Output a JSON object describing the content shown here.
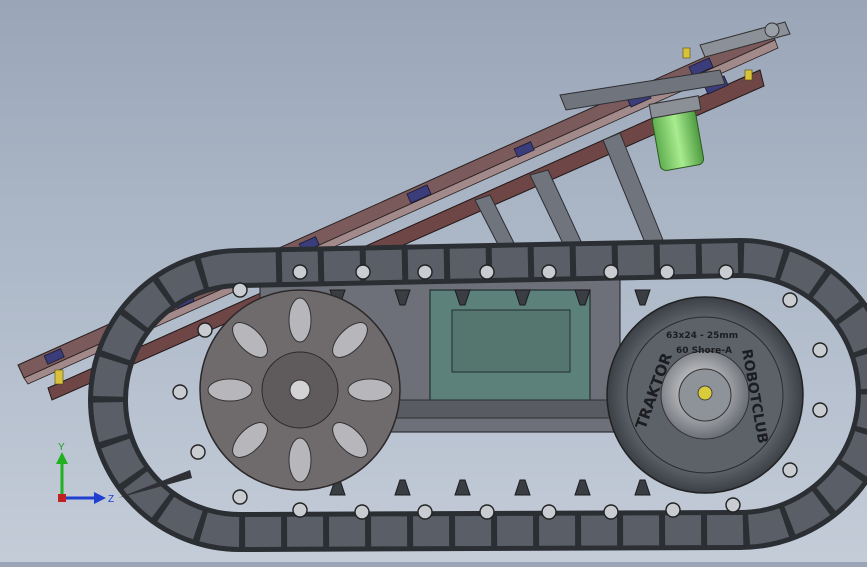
{
  "viewport": {
    "description_icon": "cad-3d-viewport",
    "background_top": "#9aa6b8",
    "background_bottom": "#c4ccd8"
  },
  "model": {
    "wheel_label_top": "63x24 - 25mm",
    "wheel_label_shore": "60 Shore-A",
    "wheel_label_left": "TRAKTOR",
    "wheel_label_right": "ROBOTCLUB"
  },
  "triad": {
    "x_label": "",
    "y_label": "Y",
    "z_label": "Z",
    "y_color": "#20b020",
    "z_color": "#1f3fd0",
    "x_color": "#c02020"
  },
  "colors": {
    "track": "#5a5e66",
    "track_dark": "#2b2e33",
    "frame": "#6d7078",
    "motor_box": "#5c807a",
    "motor_green": "#7ec86a",
    "rail": "#6b3a3a"
  }
}
